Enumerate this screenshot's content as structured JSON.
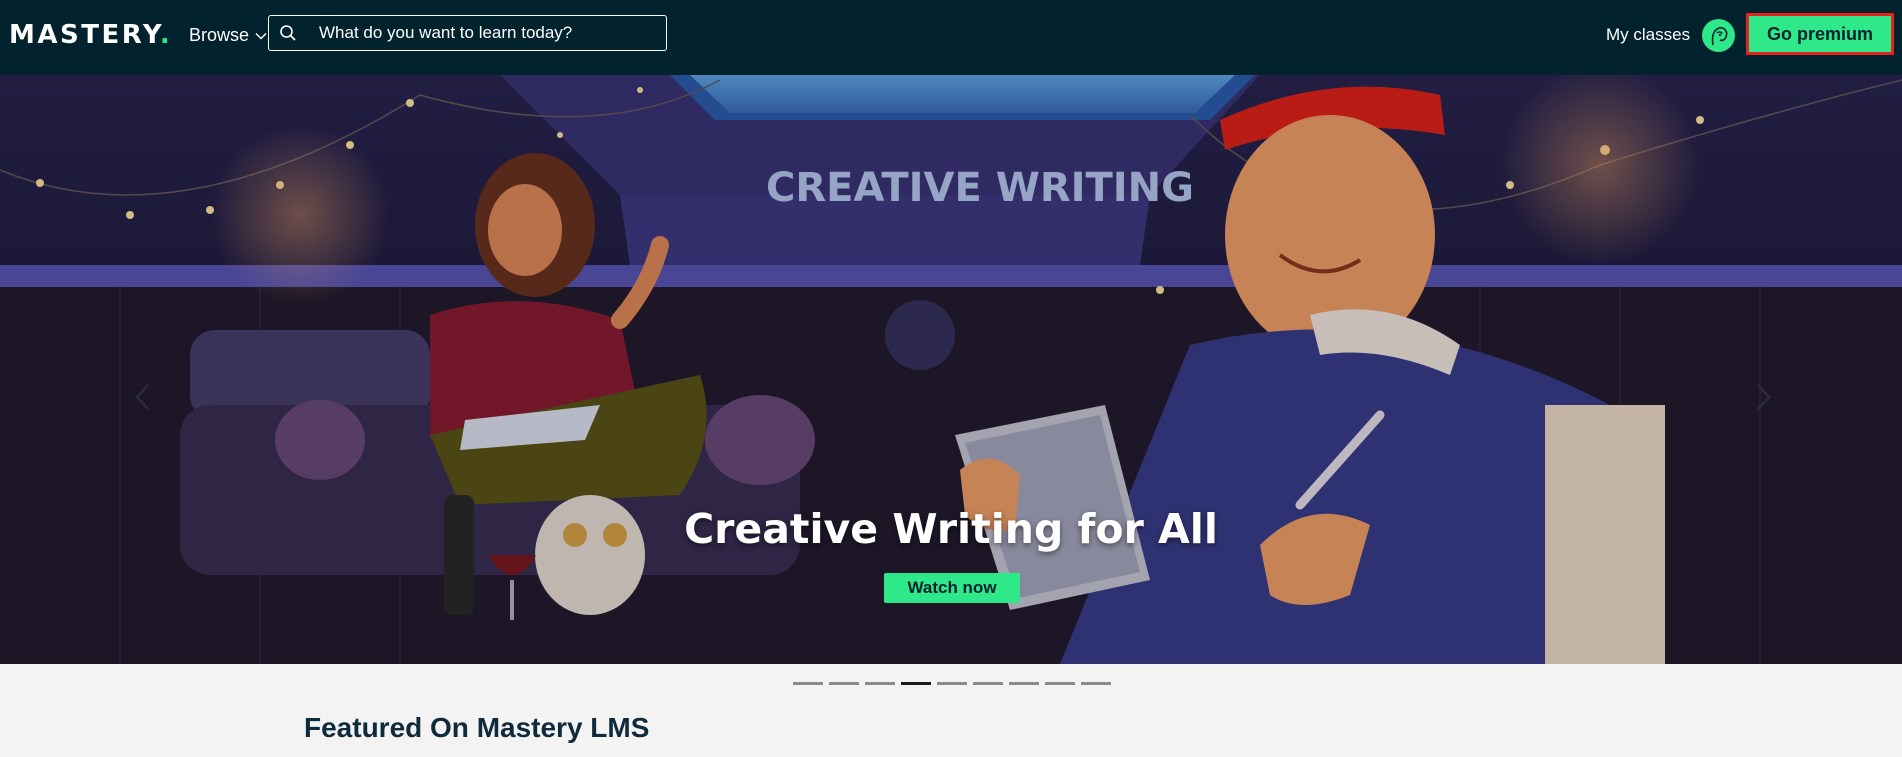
{
  "header": {
    "logo_text": "MASTERY",
    "logo_dot": ".",
    "browse_label": "Browse",
    "search_placeholder": "What do you want to learn today?",
    "my_classes_label": "My classes",
    "go_premium_label": "Go premium"
  },
  "hero": {
    "banner_text": "CREATIVE WRITING",
    "title": "Creative Writing for All",
    "cta_label": "Watch now",
    "carousel": {
      "slide_count": 9,
      "active_index": 3
    }
  },
  "featured": {
    "heading": "Featured On Mastery LMS"
  },
  "colors": {
    "accent": "#2ee88a",
    "header_bg": "#02222e",
    "highlight_border": "#e2231a"
  },
  "icons": [
    "chevron-down-icon",
    "search-icon",
    "user-avatar-icon",
    "arrow-left-icon",
    "arrow-right-icon"
  ]
}
